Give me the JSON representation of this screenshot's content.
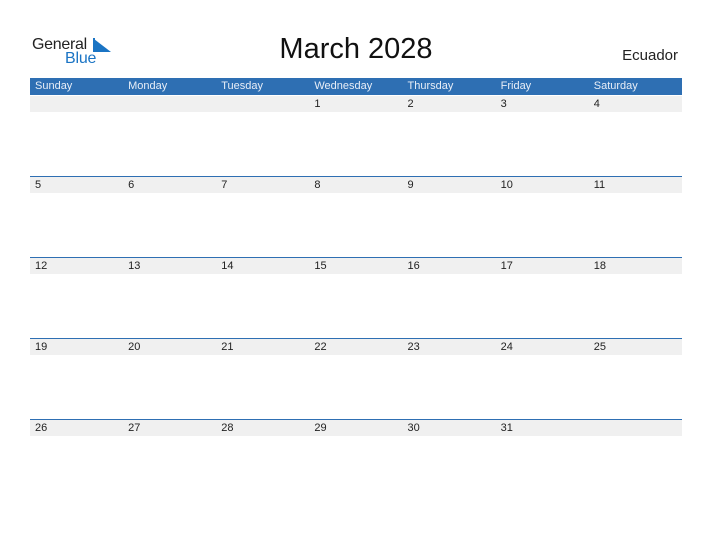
{
  "logo": {
    "word1": "General",
    "word2": "Blue",
    "icon": "triangle-flag-icon"
  },
  "title": "March 2028",
  "country": "Ecuador",
  "colors": {
    "accent": "#2e6fb3",
    "logo_blue": "#1a74c4",
    "row_bg": "#f0f0f0"
  },
  "weekdays": [
    "Sunday",
    "Monday",
    "Tuesday",
    "Wednesday",
    "Thursday",
    "Friday",
    "Saturday"
  ],
  "weeks": [
    [
      "",
      "",
      "",
      "1",
      "2",
      "3",
      "4"
    ],
    [
      "5",
      "6",
      "7",
      "8",
      "9",
      "10",
      "11"
    ],
    [
      "12",
      "13",
      "14",
      "15",
      "16",
      "17",
      "18"
    ],
    [
      "19",
      "20",
      "21",
      "22",
      "23",
      "24",
      "25"
    ],
    [
      "26",
      "27",
      "28",
      "29",
      "30",
      "31",
      ""
    ]
  ]
}
